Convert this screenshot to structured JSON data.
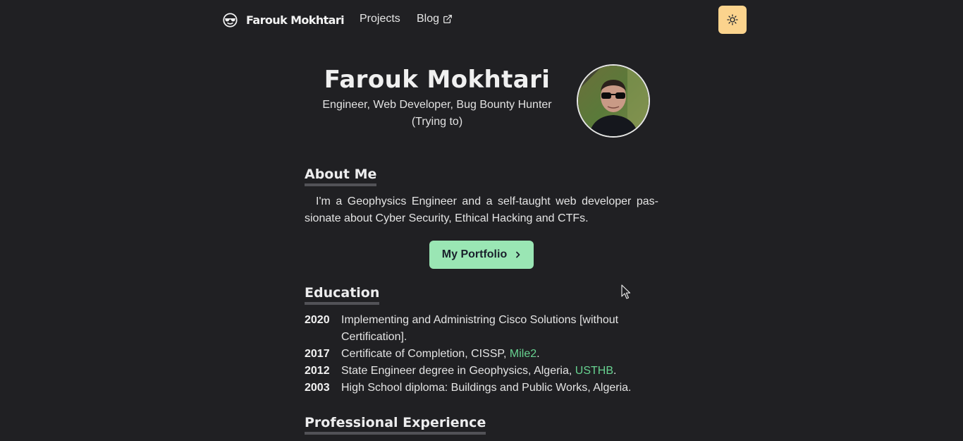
{
  "nav": {
    "brand_name": "Farouk Mokhtari",
    "links": [
      {
        "label": "Projects"
      },
      {
        "label": "Blog"
      }
    ]
  },
  "hero": {
    "name": "Farouk Mokhtari",
    "subtitle_line1": "Engineer, Web Developer, Bug Bounty Hunter",
    "subtitle_line2": "(Trying to)"
  },
  "about": {
    "title": "About Me",
    "text": "I'm a Geophysics Engineer and a self-taught web developer pas-sionate about Cyber Security, Ethical Hacking and CTFs.",
    "button_label": "My Portfolio"
  },
  "education": {
    "title": "Education",
    "items": [
      {
        "year": "2020",
        "text": "Implementing and Administring Cisco Solutions [without Certification]."
      },
      {
        "year": "2017",
        "text": "Certificate of Completion, CISSP, ",
        "link": "Mile2",
        "suffix": "."
      },
      {
        "year": "2012",
        "text": "State Engineer degree in Geophysics, Algeria, ",
        "link": "USTHB",
        "suffix": "."
      },
      {
        "year": "2003",
        "text": "High School diploma: Buildings and Public Works, Algeria."
      }
    ]
  },
  "experience": {
    "title": "Professional Experience"
  },
  "colors": {
    "background": "#202023",
    "accent_green": "#68d391",
    "button_green": "#9ae6b4",
    "theme_button": "#fbd38d"
  },
  "icons": {
    "brand": "sunglasses-face-icon",
    "blog_external": "external-link-icon",
    "theme": "sun-icon",
    "portfolio_chevron": "chevron-right-icon"
  }
}
